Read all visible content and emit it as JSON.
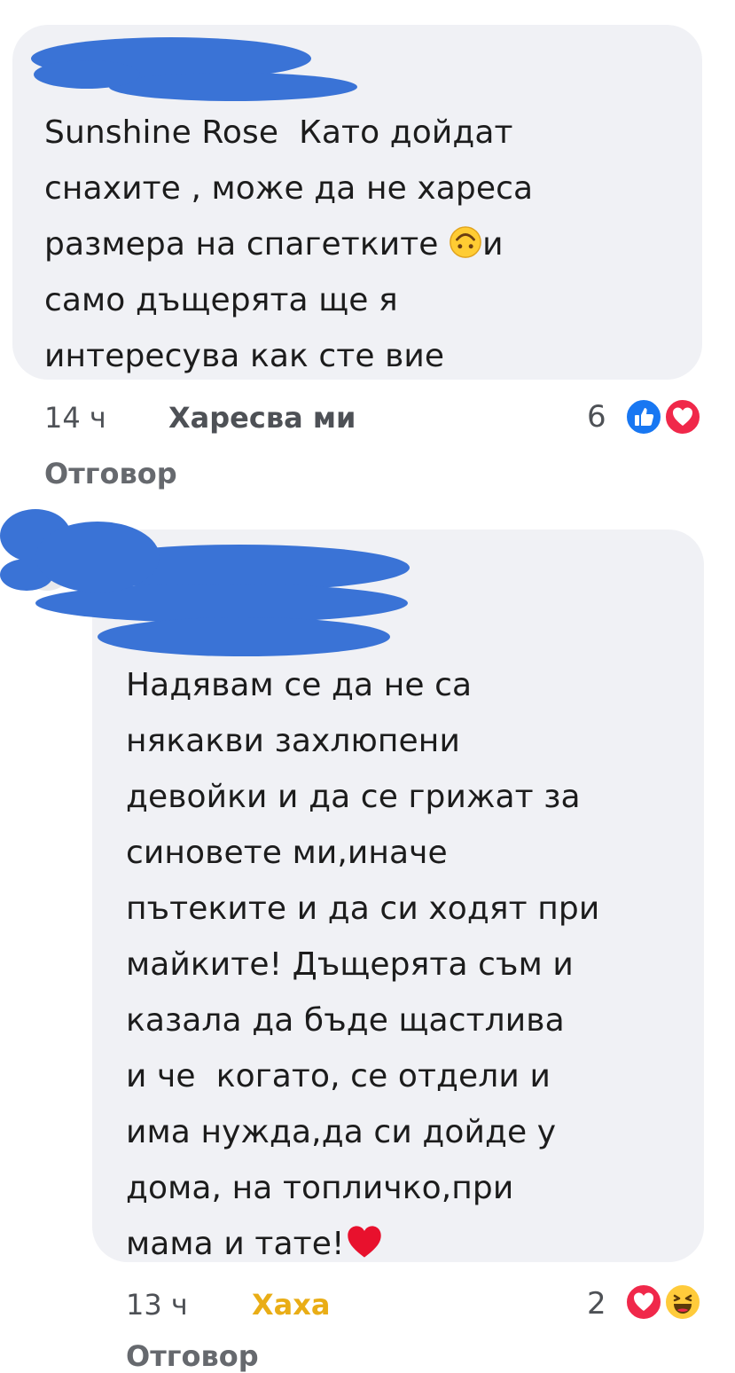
{
  "comments": [
    {
      "lines": [
        "Sunshine Rose  Като дойдат",
        "снахите , може да не хареса",
        "размера на спагетките {emoji}и",
        "само дъщерята ще я",
        "интересува как сте вие"
      ],
      "inline_emoji": "upside-down-smile",
      "time": "14 ч",
      "like_label": "Харесва ми",
      "reply_label": "Отговор",
      "reaction_count": "6",
      "reactions": [
        "like",
        "love"
      ]
    },
    {
      "lines": [
        "Надявам се да не са",
        "някакви захлюпени",
        "девойки и да се грижат за",
        "синовете ми,иначе",
        "пътеките и да си ходят при",
        "майките! Дъщерята съм и",
        "казала да бъде щастлива",
        "и че  когато, се отдели и",
        "има нужда,да си дойде у",
        "дома, на топличко,при",
        "мама и тате!{emoji}"
      ],
      "inline_emoji": "red-heart",
      "time": "13 ч",
      "like_label": "Хаха",
      "reply_label": "Отговор",
      "reaction_count": "2",
      "reactions": [
        "love",
        "haha"
      ]
    }
  ],
  "colors": {
    "bubble": "#f0f1f5",
    "redaction": "#3a73d6",
    "like_blue": "#1877f2",
    "love_red": "#f0284a",
    "haha_yellow": "#e9ad16"
  }
}
